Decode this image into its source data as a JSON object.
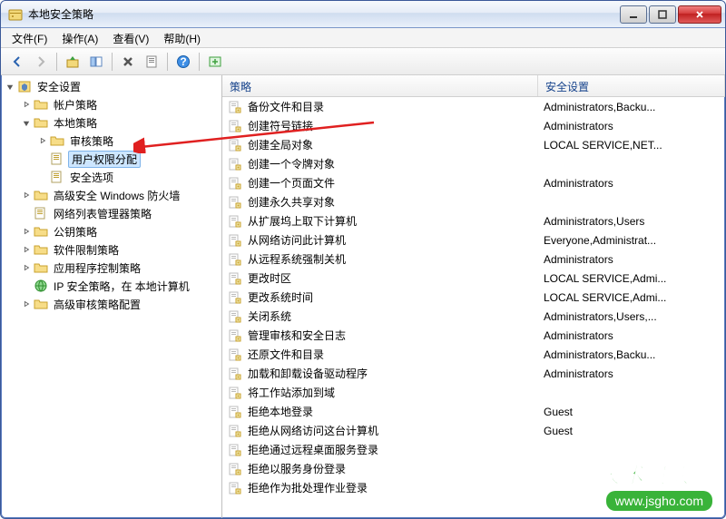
{
  "window": {
    "title": "本地安全策略"
  },
  "menubar": [
    {
      "label": "文件(F)"
    },
    {
      "label": "操作(A)"
    },
    {
      "label": "查看(V)"
    },
    {
      "label": "帮助(H)"
    }
  ],
  "tree": {
    "root": "安全设置",
    "items": [
      {
        "label": "帐户策略",
        "depth": 1,
        "expandable": true,
        "expanded": false
      },
      {
        "label": "本地策略",
        "depth": 1,
        "expandable": true,
        "expanded": true
      },
      {
        "label": "审核策略",
        "depth": 2,
        "expandable": true,
        "expanded": false
      },
      {
        "label": "用户权限分配",
        "depth": 2,
        "expandable": false,
        "selected": true
      },
      {
        "label": "安全选项",
        "depth": 2,
        "expandable": false
      },
      {
        "label": "高级安全 Windows 防火墙",
        "depth": 1,
        "expandable": true,
        "expanded": false
      },
      {
        "label": "网络列表管理器策略",
        "depth": 1,
        "expandable": false
      },
      {
        "label": "公钥策略",
        "depth": 1,
        "expandable": true,
        "expanded": false
      },
      {
        "label": "软件限制策略",
        "depth": 1,
        "expandable": true,
        "expanded": false
      },
      {
        "label": "应用程序控制策略",
        "depth": 1,
        "expandable": true,
        "expanded": false
      },
      {
        "label": "IP 安全策略，在 本地计算机",
        "depth": 1,
        "expandable": false,
        "icon": "ip"
      },
      {
        "label": "高级审核策略配置",
        "depth": 1,
        "expandable": true,
        "expanded": false
      }
    ]
  },
  "list": {
    "columns": [
      "策略",
      "安全设置"
    ],
    "rows": [
      {
        "policy": "备份文件和目录",
        "setting": "Administrators,Backu..."
      },
      {
        "policy": "创建符号链接",
        "setting": "Administrators"
      },
      {
        "policy": "创建全局对象",
        "setting": "LOCAL SERVICE,NET..."
      },
      {
        "policy": "创建一个令牌对象",
        "setting": ""
      },
      {
        "policy": "创建一个页面文件",
        "setting": "Administrators"
      },
      {
        "policy": "创建永久共享对象",
        "setting": ""
      },
      {
        "policy": "从扩展坞上取下计算机",
        "setting": "Administrators,Users"
      },
      {
        "policy": "从网络访问此计算机",
        "setting": "Everyone,Administrat..."
      },
      {
        "policy": "从远程系统强制关机",
        "setting": "Administrators"
      },
      {
        "policy": "更改时区",
        "setting": "LOCAL SERVICE,Admi..."
      },
      {
        "policy": "更改系统时间",
        "setting": "LOCAL SERVICE,Admi..."
      },
      {
        "policy": "关闭系统",
        "setting": "Administrators,Users,..."
      },
      {
        "policy": "管理审核和安全日志",
        "setting": "Administrators"
      },
      {
        "policy": "还原文件和目录",
        "setting": "Administrators,Backu..."
      },
      {
        "policy": "加载和卸载设备驱动程序",
        "setting": "Administrators"
      },
      {
        "policy": "将工作站添加到域",
        "setting": ""
      },
      {
        "policy": "拒绝本地登录",
        "setting": "Guest"
      },
      {
        "policy": "拒绝从网络访问这台计算机",
        "setting": "Guest"
      },
      {
        "policy": "拒绝通过远程桌面服务登录",
        "setting": ""
      },
      {
        "policy": "拒绝以服务身份登录",
        "setting": ""
      },
      {
        "policy": "拒绝作为批处理作业登录",
        "setting": ""
      }
    ]
  },
  "watermark": {
    "text1": "技术员联盟",
    "text2": "www.jsgho.com"
  }
}
